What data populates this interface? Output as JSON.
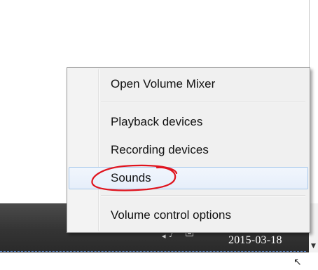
{
  "context_menu": {
    "items": [
      {
        "label": "Open Volume Mixer"
      },
      {
        "label": "Playback devices"
      },
      {
        "label": "Recording devices"
      },
      {
        "label": "Sounds",
        "highlighted": true
      },
      {
        "label": "Volume control options"
      }
    ]
  },
  "taskbar": {
    "clock_date": "2015-03-18"
  },
  "annotation": {
    "circle_color": "#e0141e"
  }
}
